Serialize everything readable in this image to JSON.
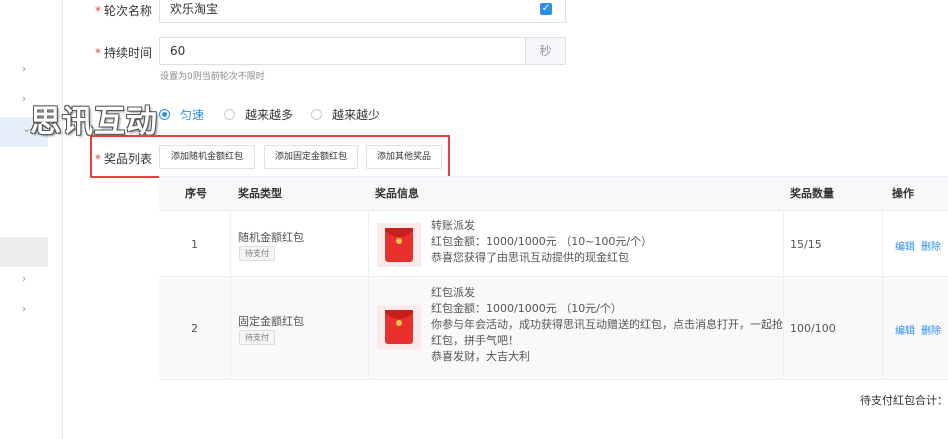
{
  "form": {
    "round_name": {
      "label": "轮次名称",
      "value": "欢乐淘宝"
    },
    "duration": {
      "label": "持续时间",
      "value": "60",
      "suffix": "秒",
      "hint": "设置为0则当前轮次不限时"
    },
    "radio_options": [
      "匀速",
      "越来越多",
      "越来越少"
    ],
    "prize_list_label": "奖品列表",
    "buttons": [
      "添加随机金额红包",
      "添加固定金额红包",
      "添加其他奖品"
    ]
  },
  "watermark": "思讯互动",
  "table": {
    "headers": [
      "序号",
      "奖品类型",
      "奖品信息",
      "奖品数量",
      "操作"
    ],
    "rows": [
      {
        "index": "1",
        "type": "随机金额红包",
        "status": "待支付",
        "info": [
          "转账派发",
          "红包金额：1000/1000元 （10~100元/个）",
          "恭喜您获得了由思讯互动提供的现金红包"
        ],
        "quantity": "15/15",
        "edit": "编辑",
        "delete": "删除"
      },
      {
        "index": "2",
        "type": "固定金额红包",
        "status": "待支付",
        "info": [
          "红包派发",
          "红包金额：1000/1000元 （10元/个）",
          "你参与年会活动，成功获得思讯互动赠送的红包，点击消息打开，一起抢",
          "红包，拼手气吧！",
          "恭喜发财，大吉大利"
        ],
        "quantity": "100/100",
        "edit": "编辑",
        "delete": "删除"
      }
    ]
  },
  "footer_sum": "待支付红包合计：",
  "colors": {
    "accent": "#2d8cf0",
    "required": "#e0443b",
    "highlight": "#e0443b"
  }
}
